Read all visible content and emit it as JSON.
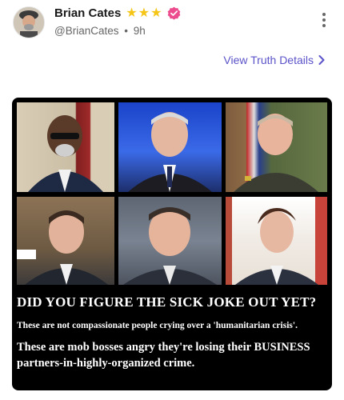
{
  "post": {
    "author": {
      "display_name": "Brian Cates",
      "handle": "@BrianCates",
      "separator": "•",
      "time_ago": "9h",
      "star_count": 3,
      "star_glyph": "★"
    },
    "view_details_label": "View Truth Details",
    "media": {
      "headline": "DID YOU FIGURE THE SICK JOKE OUT YET?",
      "line2": "These are not compassionate people crying over a 'humanitarian crisis'.",
      "line3": "These are mob bosses angry they're losing their BUSINESS partners-in-highly-organized crime."
    }
  },
  "colors": {
    "accent": "#5b53c9",
    "verified_badge": "#ec4c8d",
    "star": "#f5c518",
    "media_bg": "#000000"
  },
  "icons": [
    "more-options-icon",
    "chevron-right-icon",
    "verified-badge-icon",
    "star-icon"
  ]
}
